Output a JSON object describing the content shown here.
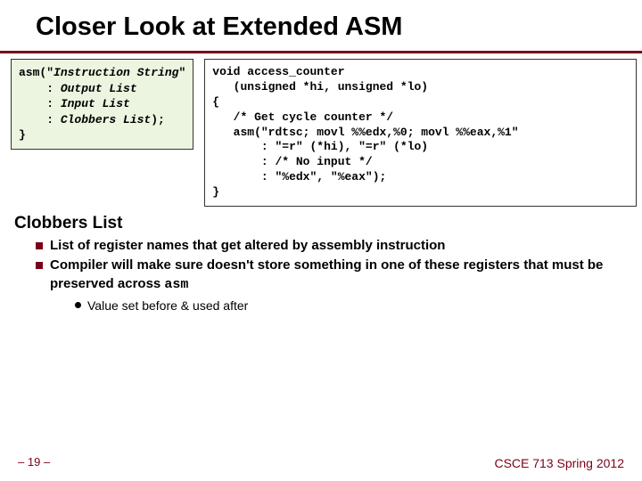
{
  "title": "Closer Look at Extended ASM",
  "leftCode": {
    "l1a": "asm(\"",
    "l1b": "Instruction String",
    "l1c": "\"",
    "l2a": "    : ",
    "l2b": "Output List",
    "l3a": "    : ",
    "l3b": "Input List",
    "l4a": "    : ",
    "l4b": "Clobbers List",
    "l4c": ");",
    "l5": "}"
  },
  "rightCode": {
    "l1": "void access_counter",
    "l2": "   (unsigned *hi, unsigned *lo)",
    "l3": "{",
    "l4": "   /* Get cycle counter */",
    "l5": "   asm(\"rdtsc; movl %%edx,%0; movl %%eax,%1\"",
    "l6": "       : \"=r\" (*hi), \"=r\" (*lo)",
    "l7": "       : /* No input */",
    "l8": "       : \"%edx\", \"%eax\");",
    "l9": "}"
  },
  "sectionHeading": "Clobbers List",
  "bullets": [
    "List of register names that get altered by assembly instruction",
    "Compiler will make sure doesn't store something in one of these registers that must be preserved across "
  ],
  "asmKeyword": "asm",
  "subBullet": "Value set before & used after",
  "footerLeft": "– 19 –",
  "footerRight": "CSCE 713 Spring 2012"
}
